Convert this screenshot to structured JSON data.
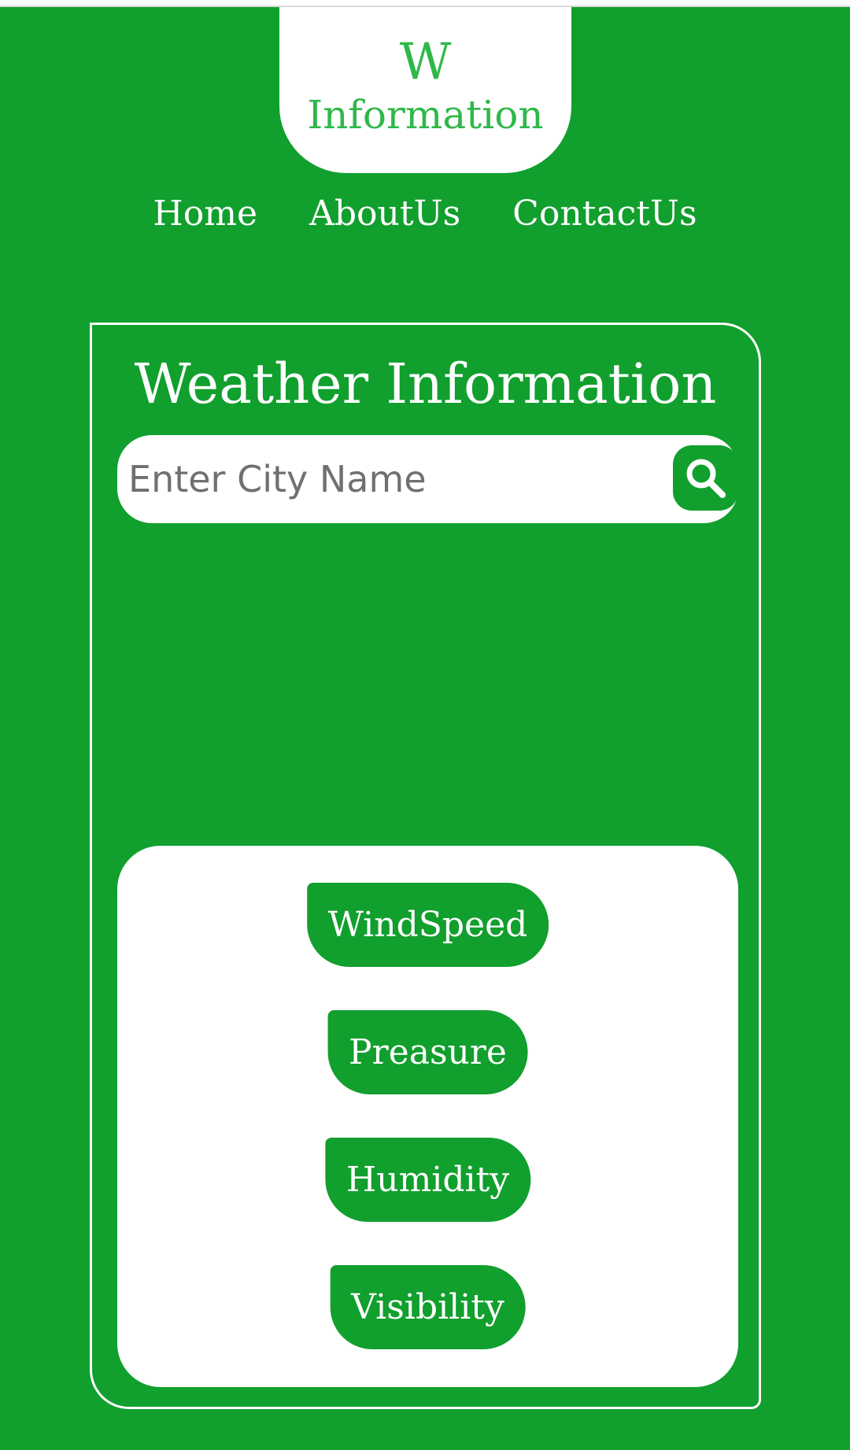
{
  "logo": {
    "line1": "W",
    "line2": "Information"
  },
  "nav": {
    "items": [
      "Home",
      "AboutUs",
      "ContactUs"
    ]
  },
  "card": {
    "title": "Weather Information",
    "search": {
      "placeholder": "Enter City Name",
      "value": "",
      "button_icon": "search-icon"
    },
    "metrics": [
      "WindSpeed",
      "Preasure",
      "Humidity",
      "Visibility"
    ]
  },
  "colors": {
    "background": "#119f2d",
    "logo_text": "#2fb84a",
    "surface": "#ffffff"
  }
}
